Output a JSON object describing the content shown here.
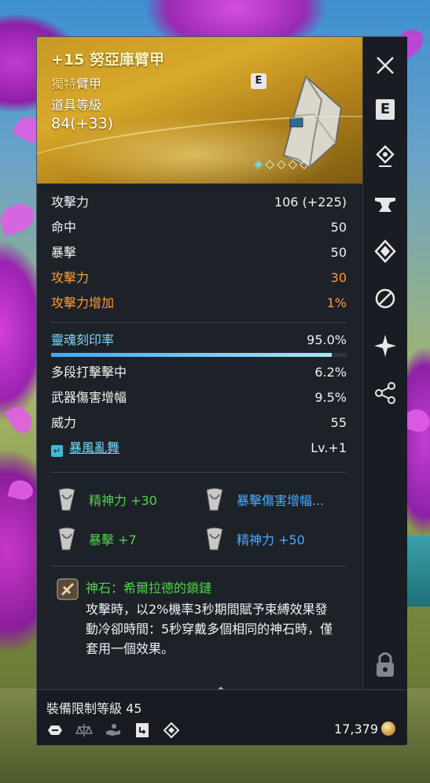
{
  "item": {
    "title": "+15 努亞庫臂甲",
    "grade": "獨特",
    "type": "臂甲",
    "level_label": "道具等級",
    "level_value": "84(+33)",
    "badge": "E",
    "quality_stars": "◈◇◇◇◇"
  },
  "stats": {
    "base": [
      {
        "label": "攻擊力",
        "value": "106 (+225)"
      },
      {
        "label": "命中",
        "value": "50"
      },
      {
        "label": "暴擊",
        "value": "50"
      }
    ],
    "bonus": [
      {
        "label": "攻擊力",
        "value": "30"
      },
      {
        "label": "攻擊力增加",
        "value": "1%"
      }
    ],
    "soul": {
      "label": "靈魂刻印率",
      "value": "95.0%",
      "fill_fraction": 0.95
    },
    "engraved": [
      {
        "label": "多段打擊擊中",
        "value": "6.2%"
      },
      {
        "label": "武器傷害增幅",
        "value": "9.5%"
      },
      {
        "label": "威力",
        "value": "55"
      }
    ],
    "skill": {
      "name": "暴風亂舞",
      "value": "Lv.+1"
    }
  },
  "runes": [
    {
      "text": "精神力 +30",
      "color": "green"
    },
    {
      "text": "暴擊傷害增幅...",
      "color": "blue"
    },
    {
      "text": "暴擊 +7",
      "color": "green"
    },
    {
      "text": "精神力 +50",
      "color": "blue"
    }
  ],
  "gem": {
    "title": "神石：希爾拉德的鎖鏈",
    "description": "攻擊時，以2%機率3秒期間賦予束縛效果發動冷卻時間：5秒穿戴多個相同的神石時，僅套用一個效果。"
  },
  "footer": {
    "requirement": "裝備限制等級 45",
    "gold": "17,379",
    "icons": [
      "bind-icon",
      "balance-icon",
      "hand-icon",
      "skill-book-icon",
      "diamond-icon"
    ]
  },
  "sidebar": {
    "buttons": [
      "close-icon",
      "equip-e-icon",
      "location-pin-icon",
      "anvil-icon",
      "soul-crest-icon",
      "link-rings-icon",
      "star-burst-icon",
      "share-icon",
      "lock-icon"
    ],
    "equip_label": "E"
  },
  "colors": {
    "header_gold": "#d9a92a",
    "bonus_orange": "#ff9a2e",
    "soul_blue": "#7fd8ff",
    "rune_green": "#4fd24a",
    "rune_blue": "#4aa8ff"
  }
}
